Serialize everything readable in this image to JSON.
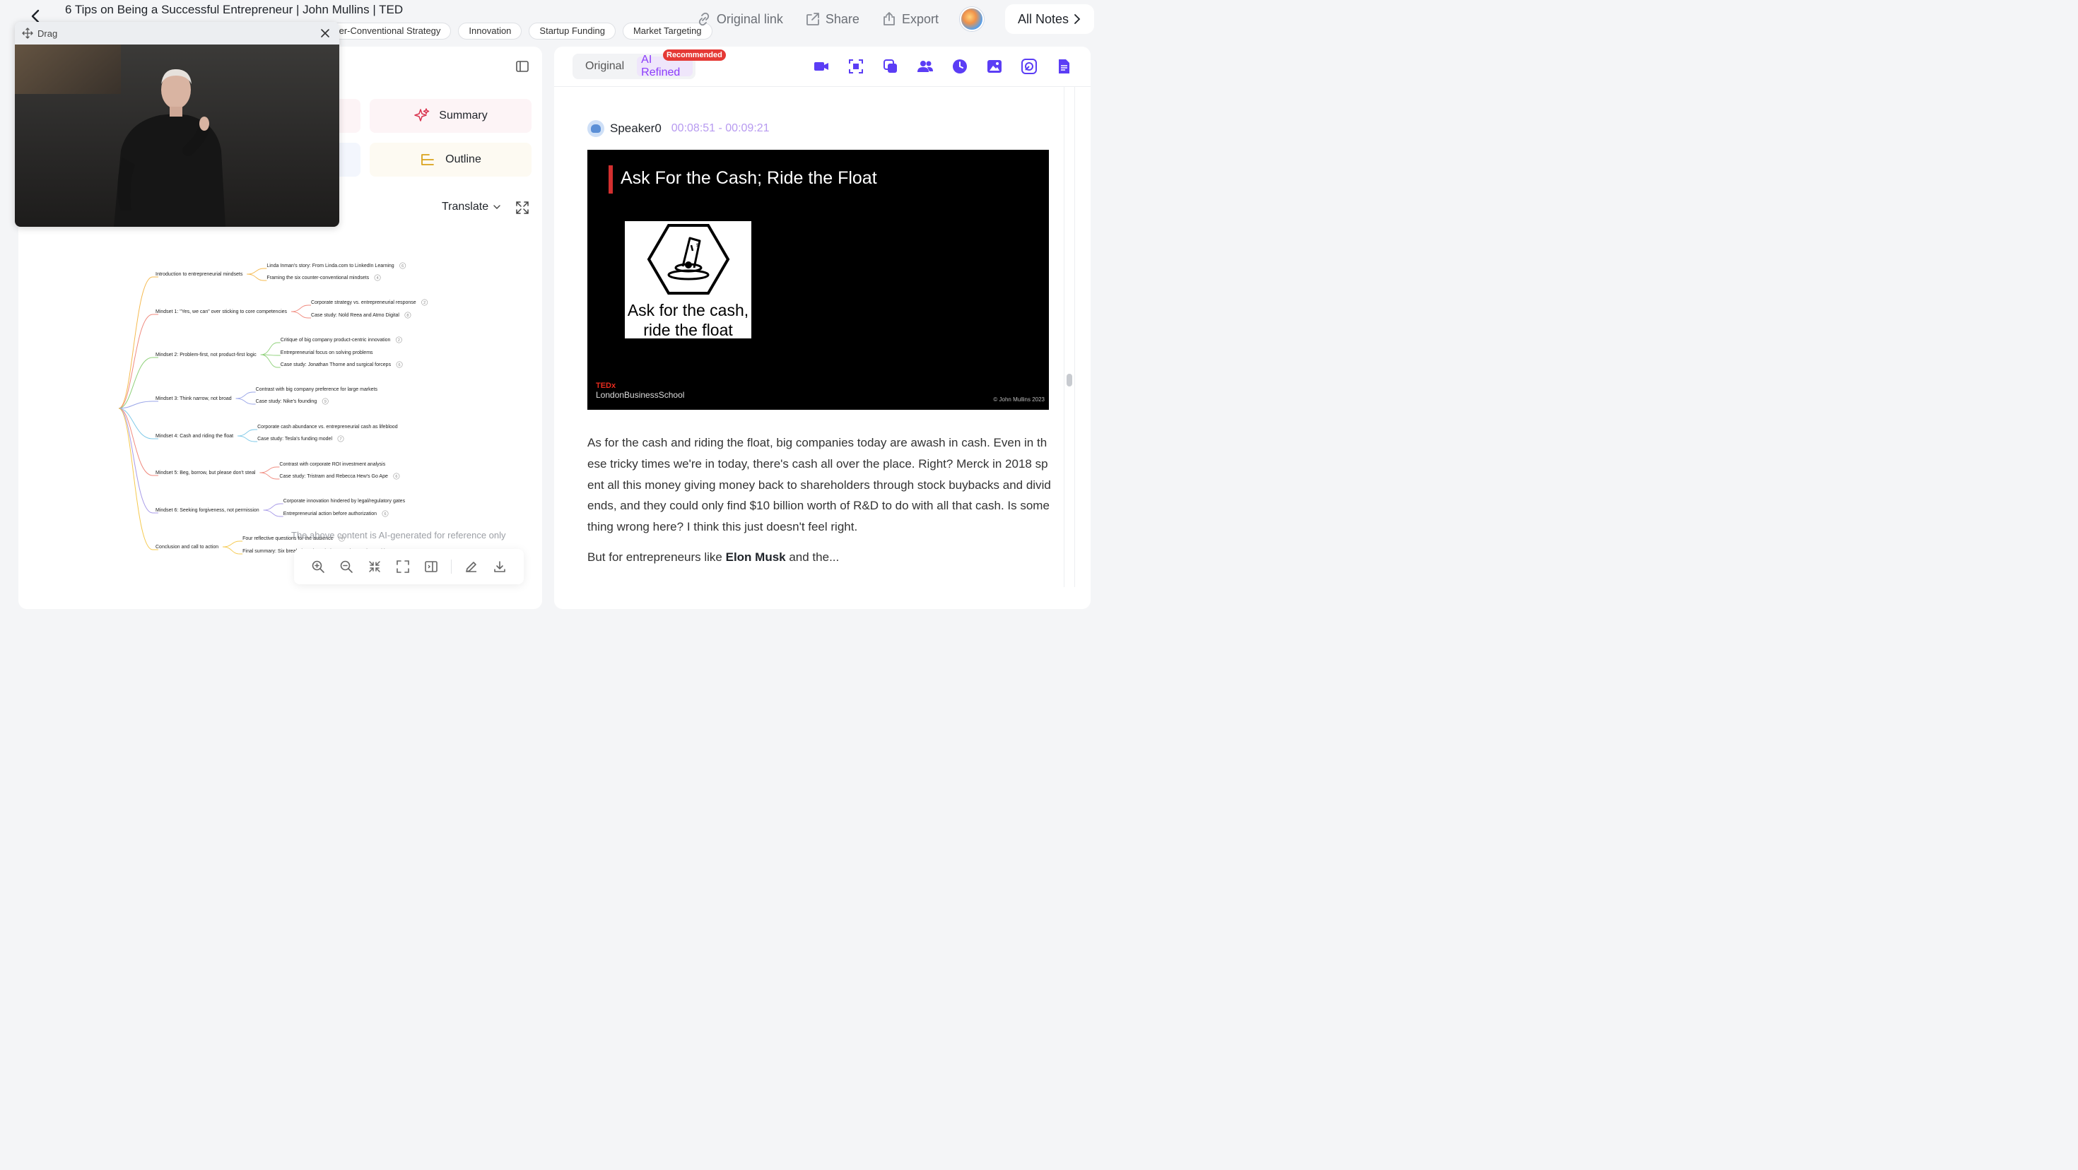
{
  "header": {
    "title": "6 Tips on Being a Successful Entrepreneur | John Mullins | TED",
    "tags": [
      "ter-Conventional Strategy",
      "Innovation",
      "Startup Funding",
      "Market Targeting"
    ],
    "actions": {
      "original_link": "Original link",
      "share": "Share",
      "export": "Export"
    },
    "all_notes": "All Notes"
  },
  "video_float": {
    "drag_label": "Drag"
  },
  "left_panel": {
    "summary_label": "Summary",
    "outline_label": "Outline",
    "translate_label": "Translate",
    "disclaimer": "The above content is AI-generated for reference only"
  },
  "mindmap": {
    "branches": [
      {
        "label": "Introduction to entrepreneurial mindsets",
        "color": "#f5b94e",
        "children": [
          {
            "label": "Linda Inman's story: From Linda.com to LinkedIn Learning",
            "badge": "6"
          },
          {
            "label": "Framing the six counter-conventional mindsets",
            "badge": "4"
          }
        ]
      },
      {
        "label": "Mindset 1: \"Yes, we can\" over sticking to core competencies",
        "color": "#f08a7e",
        "children": [
          {
            "label": "Corporate strategy vs. entrepreneurial response",
            "badge": "2"
          },
          {
            "label": "Case study: Nold Reea and Atmo Digital",
            "badge": "8"
          }
        ]
      },
      {
        "label": "Mindset 2: Problem-first, not product-first logic",
        "color": "#8fd17a",
        "children": [
          {
            "label": "Critique of big company product-centric innovation",
            "badge": "2"
          },
          {
            "label": "Entrepreneurial focus on solving problems",
            "badge": ""
          },
          {
            "label": "Case study: Jonathan Thorne and surgical forceps",
            "badge": "6"
          }
        ]
      },
      {
        "label": "Mindset 3: Think narrow, not broad",
        "color": "#9aa6e8",
        "children": [
          {
            "label": "Contrast with big company preference for large markets",
            "badge": ""
          },
          {
            "label": "Case study: Nike's founding",
            "badge": "9"
          }
        ]
      },
      {
        "label": "Mindset 4: Cash and riding the float",
        "color": "#7fc9e8",
        "children": [
          {
            "label": "Corporate cash abundance vs. entrepreneurial cash as lifeblood",
            "badge": ""
          },
          {
            "label": "Case study: Tesla's funding model",
            "badge": "7"
          }
        ]
      },
      {
        "label": "Mindset 5: Beg, borrow, but please don't steal",
        "color": "#f08a7e",
        "children": [
          {
            "label": "Contrast with corporate ROI investment analysis",
            "badge": ""
          },
          {
            "label": "Case study: Tristram and Rebecca Hew's Go Ape",
            "badge": "6"
          }
        ]
      },
      {
        "label": "Mindset 6: Seeking forgiveness, not permission",
        "color": "#a89be8",
        "children": [
          {
            "label": "Corporate innovation hindered by legal/regulatory gates",
            "badge": ""
          },
          {
            "label": "Entrepreneurial action before authorization",
            "badge": "6"
          }
        ]
      },
      {
        "label": "Conclusion and call to action",
        "color": "#f5c94e",
        "children": [
          {
            "label": "Four reflective questions for the audience",
            "badge": "4"
          },
          {
            "label": "Final summary: Six break-the-rules mindsets to change the world",
            "badge": ""
          }
        ]
      }
    ]
  },
  "right_panel": {
    "view_original": "Original",
    "view_ai_refined": "AI Refined",
    "recommended_badge": "Recommended",
    "speaker_name": "Speaker0",
    "time_range": "00:08:51 - 00:09:21",
    "slide": {
      "title": "Ask For the Cash; Ride the Float",
      "card_line1": "Ask for the cash,",
      "card_line2": "ride the float",
      "tedx_logo": "TEDx",
      "tedx_event": "LondonBusinessSchool",
      "copyright": "© John Mullins 2023"
    },
    "transcript_p1": "As for the cash and riding the float, big companies today are awash in cash. Even in these tricky times we're in today, there's cash all over the place. Right? Merck in 2018 spent all this money giving money back to shareholders through stock buybacks and dividends, and they could only find $10 billion worth of R&D to do with all that cash. Is something wrong here? I think this just doesn't feel right.",
    "transcript_p2_start": "But for entrepreneurs like ",
    "transcript_p2_bold": "Elon Musk",
    "transcript_p2_end": " and the..."
  }
}
